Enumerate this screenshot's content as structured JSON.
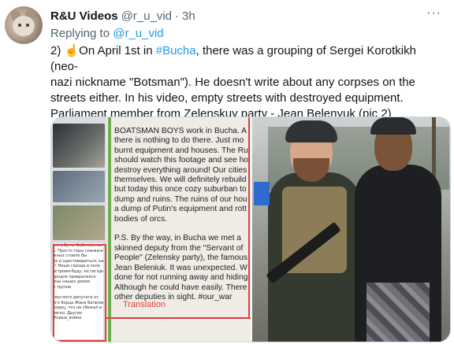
{
  "tweet": {
    "display_name": "R&U Videos",
    "handle": "@r_u_vid",
    "separator": "·",
    "time": "3h",
    "more_label": "···",
    "replying_prefix": "Replying to",
    "replying_to": "@r_u_vid",
    "text": {
      "line1_a": "2) ☝️On April 1st in ",
      "line1_tag": "#Bucha",
      "line1_b": ", there was a grouping of Sergei Korotkikh (neo-",
      "line2": "nazi nickname \"Botsman\").  He doesn't write about any corpses on the",
      "line3": "streets either. In his video, empty streets with destroyed equipment.",
      "line4": "Parliament member from Zelenskuy party - Jean Belenyuk (pic 2)"
    }
  },
  "media": {
    "left_image": {
      "translation_lines": [
        "BOATSMAN BOYS work in Bucha. A",
        "there is nothing to do there. Just mo",
        "burnt equipment and houses. The Ru",
        "should watch this footage and see ho",
        "destroy everything around! Our cities",
        "themselves. We will definitely rebuild",
        "but today this once cozy suburban to",
        "dump and ruins. The ruins of our hou",
        "a dump of Putin's equipment and rott",
        "bodies of orcs.",
        "",
        "P.S. By the way, in Bucha we met a",
        "skinned deputy from the \"Servant of",
        "People\" (Zelensky party), the famous",
        "Jean Beleniuk. It was unexpected. W",
        "done for not running away and hiding",
        "Although he could have easily. There",
        "other deputies in sight. #our_war"
      ],
      "translation_label": "Translation",
      "original_lines": [
        "...и в Буче. Собственно,",
        "ь. Просто горы сожженной",
        "жных стоило бы",
        "их и удостовериться, как они",
        "т! Наши города и села",
        "остроим-буду, но сегодня",
        "ородок превратился",
        "ины наших домов",
        "и трупов",
        "",
        "смуглого депутата от",
        "ого борца Жана Беленюка.",
        "лодец, что не сбежал и",
        "легко. Других",
        "#наша_война"
      ]
    }
  },
  "colors": {
    "accent": "#1d9bf0",
    "secondary_text": "#536471",
    "annotation_red": "#e0403f",
    "border": "#cfd9de"
  }
}
